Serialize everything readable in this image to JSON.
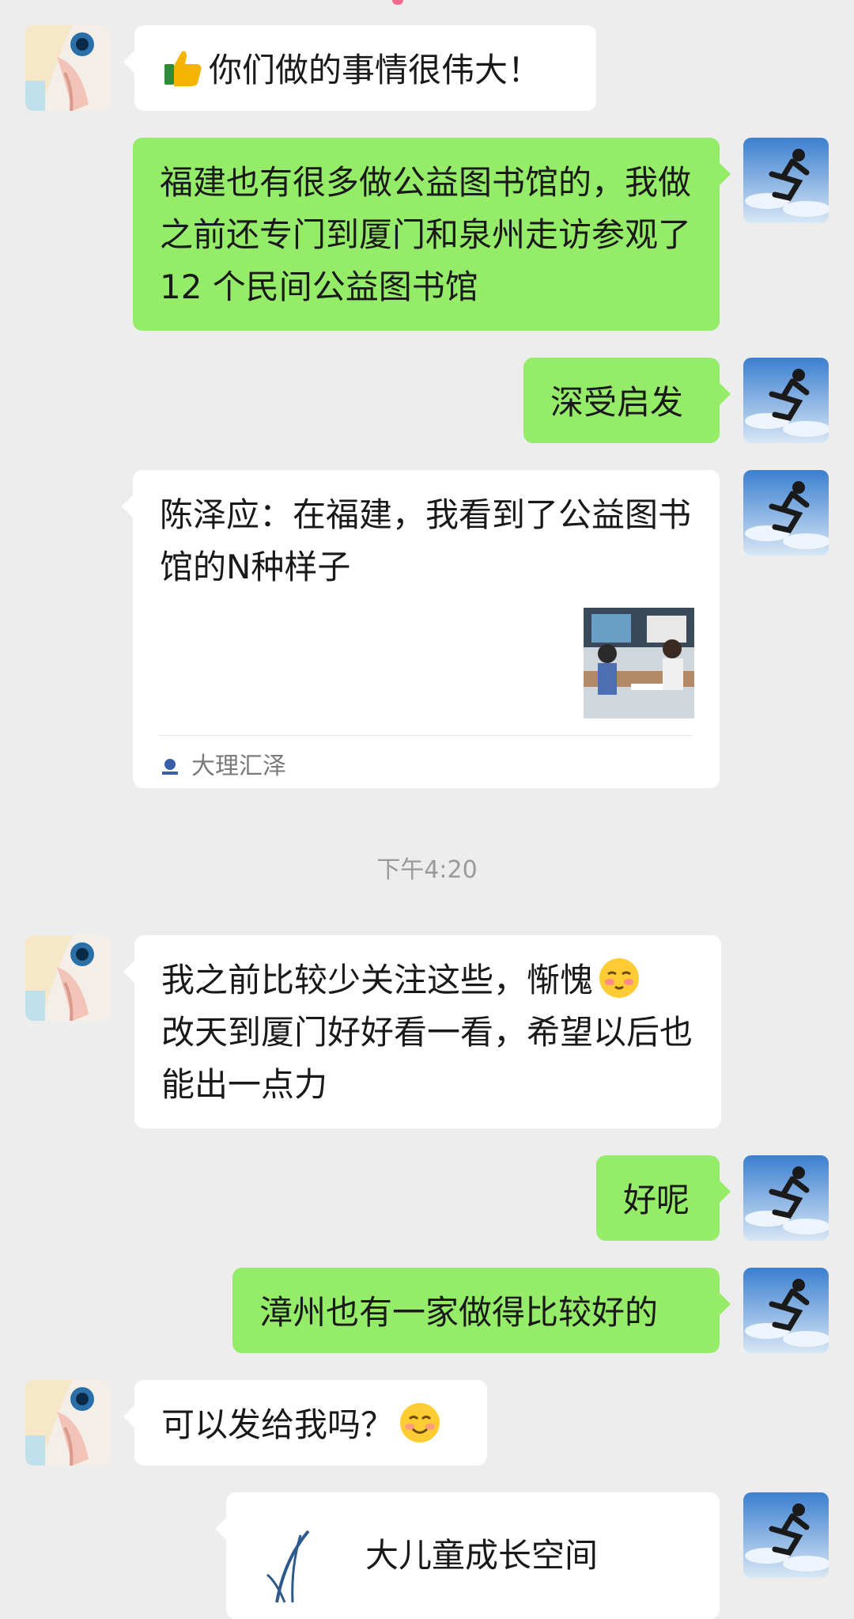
{
  "messages": [
    {
      "id": "m1",
      "side": "left",
      "text": "你们做的事情很伟大！",
      "emoji_before": "thumbs-up-icon"
    },
    {
      "id": "m2",
      "side": "right",
      "text": "福建也有很多做公益图书馆的，我做之前还专门到厦门和泉州走访参观了12 个民间公益图书馆"
    },
    {
      "id": "m3",
      "side": "right",
      "text": "深受启发"
    },
    {
      "id": "m4",
      "side": "right",
      "type": "link-card",
      "title": "陈泽应：在福建，我看到了公益图书馆的N种样子",
      "source": "大理汇泽",
      "thumb_icon": "library-photo"
    },
    {
      "id": "ts",
      "type": "timestamp",
      "text": "下午4:20"
    },
    {
      "id": "m5",
      "side": "left",
      "text": "我之前比较少关注这些，惭愧",
      "emoji_after": "shy-face-icon",
      "text2": "改天到厦门好好看一看，希望以后也能出一点力"
    },
    {
      "id": "m6",
      "side": "right",
      "text": "好呢"
    },
    {
      "id": "m7",
      "side": "right",
      "text": "漳州也有一家做得比较好的"
    },
    {
      "id": "m8",
      "side": "left",
      "text": "可以发给我吗？",
      "emoji_after": "smile-face-icon"
    },
    {
      "id": "m9",
      "side": "right",
      "type": "contact-card",
      "title": "大儿童成长空间"
    }
  ],
  "colors": {
    "background": "#ededed",
    "incoming": "#ffffff",
    "outgoing": "#95ec69"
  }
}
